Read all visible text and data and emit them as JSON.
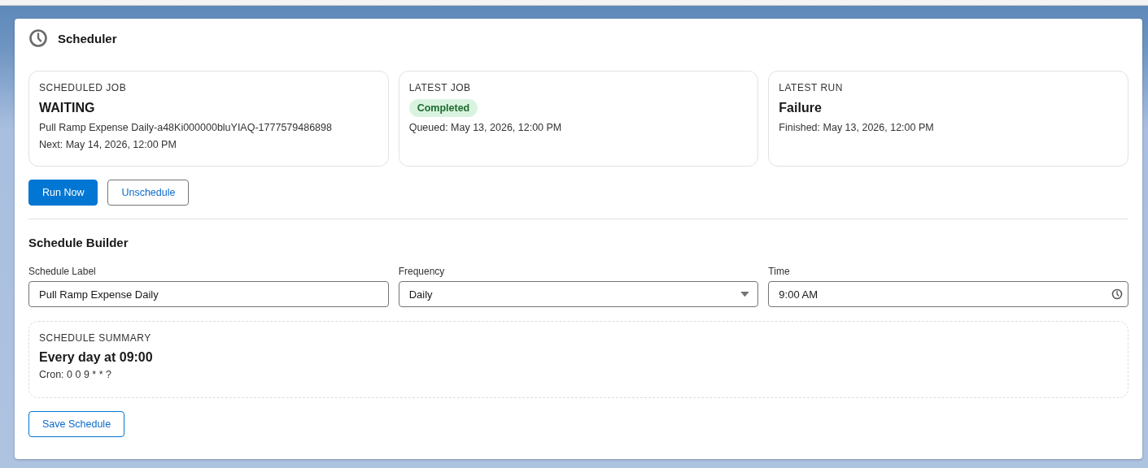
{
  "panel": {
    "title": "Scheduler"
  },
  "status_cards": [
    {
      "label": "SCHEDULED JOB",
      "kind": "text",
      "value": "WAITING",
      "lines": [
        "Pull Ramp Expense Daily-a48Ki000000bluYIAQ-1777579486898",
        "Next: May 14, 2026, 12:00 PM"
      ]
    },
    {
      "label": "LATEST JOB",
      "kind": "badge",
      "value": "Completed",
      "lines": [
        "Queued: May 13, 2026, 12:00 PM"
      ]
    },
    {
      "label": "LATEST RUN",
      "kind": "text",
      "value": "Failure",
      "lines": [
        "Finished: May 13, 2026, 12:00 PM"
      ]
    }
  ],
  "actions": [
    {
      "label": "Run Now",
      "kind": "primary"
    },
    {
      "label": "Unschedule",
      "kind": "outline"
    }
  ],
  "builder": {
    "title": "Schedule Builder",
    "fields": [
      {
        "label": "Schedule Label",
        "kind": "text",
        "value": "Pull Ramp Expense Daily"
      },
      {
        "label": "Frequency",
        "kind": "select",
        "value": "Daily"
      },
      {
        "label": "Time",
        "kind": "time",
        "value": "9:00 AM"
      }
    ],
    "summary": {
      "label": "SCHEDULE SUMMARY",
      "title": "Every day at 09:00",
      "cron": "Cron: 0 0 9 * * ?"
    },
    "save_button": "Save Schedule"
  }
}
